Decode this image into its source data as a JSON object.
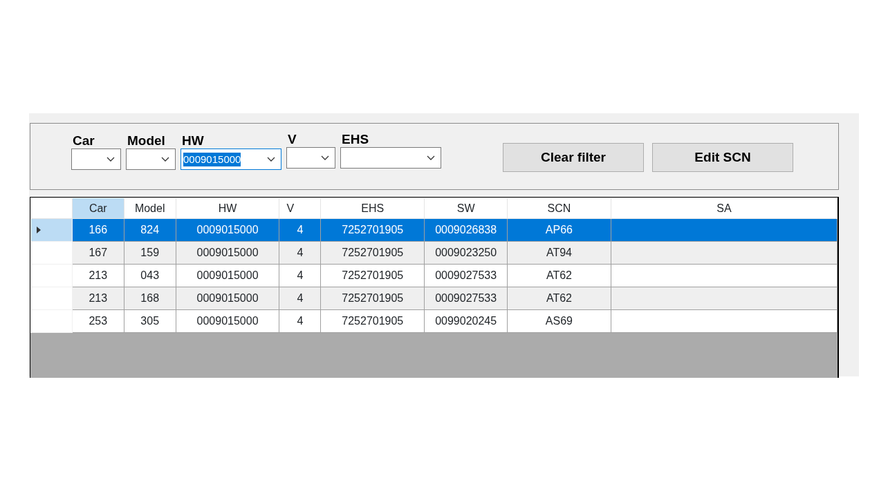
{
  "filters": [
    {
      "label": "Car",
      "focused": false
    },
    {
      "label": "Model",
      "focused": false
    },
    {
      "label": "HW",
      "value": "0009015000",
      "focused": true
    },
    {
      "label": "V",
      "focused": false
    },
    {
      "label": "EHS",
      "focused": false
    }
  ],
  "buttons": [
    "Clear filter",
    "Edit SCN"
  ],
  "table": {
    "columns": [
      {
        "label": "Car",
        "selected": true
      },
      {
        "label": "Model",
        "selected": false
      },
      {
        "label": "HW",
        "selected": false
      },
      {
        "label": "V",
        "selected": false
      },
      {
        "label": "EHS",
        "selected": false
      },
      {
        "label": "SW",
        "selected": false
      },
      {
        "label": "SCN",
        "selected": false
      },
      {
        "label": "SA",
        "selected": false
      }
    ],
    "rows": [
      {
        "selected": true,
        "cells": [
          "166",
          "824",
          "0009015000",
          "4",
          "7252701905",
          "0009026838",
          "AP66",
          ""
        ]
      },
      {
        "selected": false,
        "cells": [
          "167",
          "159",
          "0009015000",
          "4",
          "7252701905",
          "0009023250",
          "AT94",
          ""
        ]
      },
      {
        "selected": false,
        "cells": [
          "213",
          "043",
          "0009015000",
          "4",
          "7252701905",
          "0009027533",
          "AT62",
          ""
        ]
      },
      {
        "selected": false,
        "cells": [
          "213",
          "168",
          "0009015000",
          "4",
          "7252701905",
          "0009027533",
          "AT62",
          ""
        ]
      },
      {
        "selected": false,
        "cells": [
          "253",
          "305",
          "0009015000",
          "4",
          "7252701905",
          "0099020245",
          "AS69",
          ""
        ]
      }
    ]
  }
}
